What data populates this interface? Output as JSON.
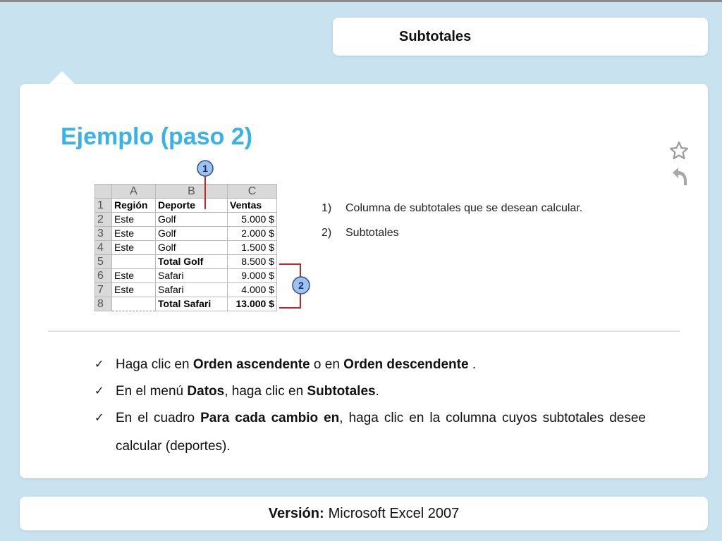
{
  "header": {
    "title": "Subtotales"
  },
  "main": {
    "heading": "Ejemplo (paso 2)",
    "icons": {
      "star": "star-icon",
      "undo": "undo-arrow-icon"
    },
    "colors": {
      "heading": "#3ab2e8",
      "background": "#c9e2f0",
      "callout_line": "#c0272d",
      "callout_badge": "#9fc1ef"
    },
    "spreadsheet": {
      "columns": [
        "A",
        "B",
        "C"
      ],
      "rows": [
        {
          "n": "1",
          "a": "Región",
          "b": "Deporte",
          "c": "Ventas"
        },
        {
          "n": "2",
          "a": "Este",
          "b": "Golf",
          "c": "5.000 $"
        },
        {
          "n": "3",
          "a": "Este",
          "b": "Golf",
          "c": "2.000 $"
        },
        {
          "n": "4",
          "a": "Este",
          "b": "Golf",
          "c": "1.500 $"
        },
        {
          "n": "5",
          "a": "",
          "b": "Total Golf",
          "c": "8.500 $"
        },
        {
          "n": "6",
          "a": "Este",
          "b": "Safari",
          "c": "9.000 $"
        },
        {
          "n": "7",
          "a": "Este",
          "b": "Safari",
          "c": "4.000 $"
        },
        {
          "n": "8",
          "a": "",
          "b": "Total Safari",
          "c": "13.000 $"
        }
      ],
      "callouts": [
        "1",
        "2"
      ]
    },
    "notes": [
      {
        "num": "1)",
        "text": "Columna de subtotales que se desean calcular."
      },
      {
        "num": "2)",
        "text": "Subtotales"
      }
    ],
    "steps": [
      {
        "check": "✓",
        "parts": [
          "Haga clic en ",
          "Orden ascendente",
          " o en ",
          "Orden descendente",
          " ."
        ]
      },
      {
        "check": "✓",
        "parts": [
          "En el menú ",
          "Datos",
          ", haga clic en ",
          "Subtotales",
          "."
        ]
      },
      {
        "check": "✓",
        "parts": [
          "En el cuadro ",
          "Para cada cambio en",
          ", haga clic en la columna cuyos subtotales desee calcular (deportes)."
        ]
      }
    ]
  },
  "footer": {
    "label": "Versión:",
    "value": "Microsoft Excel 2007"
  }
}
